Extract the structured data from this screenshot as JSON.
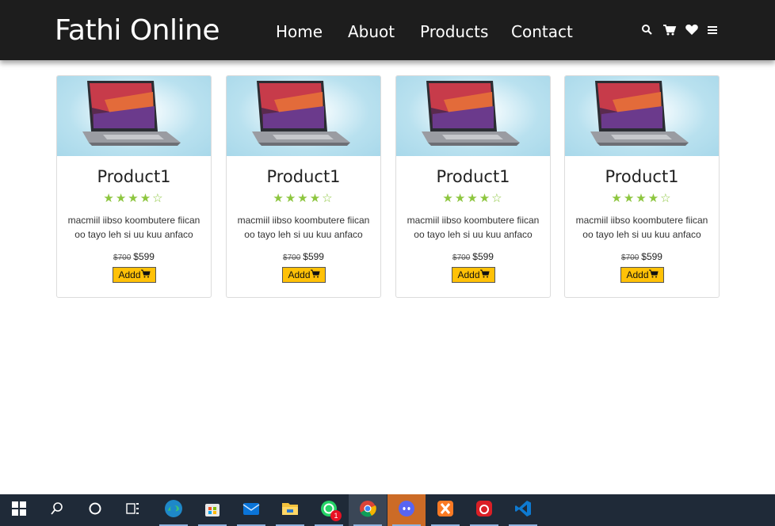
{
  "navbar": {
    "brand": "Fathi Online",
    "links": [
      "Home",
      "Abuot",
      "Products",
      "Contact"
    ],
    "icons": [
      "search-icon",
      "cart-icon",
      "heart-icon",
      "menu-icon"
    ]
  },
  "products": [
    {
      "title": "Product1",
      "rating": 4,
      "rating_max": 5,
      "description": "macmiil iibso koombutere fiican oo tayo leh si uu kuu anfaco",
      "old_price": "$700",
      "price": "$599",
      "button": "Addd"
    },
    {
      "title": "Product1",
      "rating": 4,
      "rating_max": 5,
      "description": "macmiil iibso koombutere fiican oo tayo leh si uu kuu anfaco",
      "old_price": "$700",
      "price": "$599",
      "button": "Addd"
    },
    {
      "title": "Product1",
      "rating": 4,
      "rating_max": 5,
      "description": "macmiil iibso koombutere fiican oo tayo leh si uu kuu anfaco",
      "old_price": "$700",
      "price": "$599",
      "button": "Addd"
    },
    {
      "title": "Product1",
      "rating": 4,
      "rating_max": 5,
      "description": "macmiil iibso koombutere fiican oo tayo leh si uu kuu anfaco",
      "old_price": "$700",
      "price": "$599",
      "button": "Addd"
    }
  ],
  "taskbar": {
    "apps": [
      "start-icon",
      "search-icon",
      "cortana-icon",
      "task-view-icon",
      "edge-icon",
      "store-icon",
      "mail-icon",
      "file-explorer-icon",
      "whatsapp-icon",
      "chrome-icon",
      "discord-icon",
      "xampp-icon",
      "creative-cloud-icon",
      "vscode-icon"
    ],
    "whatsapp_badge": "1"
  },
  "colors": {
    "navbar_bg": "#1d1d1d",
    "star_green": "#8dc63f",
    "button_yellow": "#ffc107",
    "taskbar_bg": "#1f2a38"
  }
}
